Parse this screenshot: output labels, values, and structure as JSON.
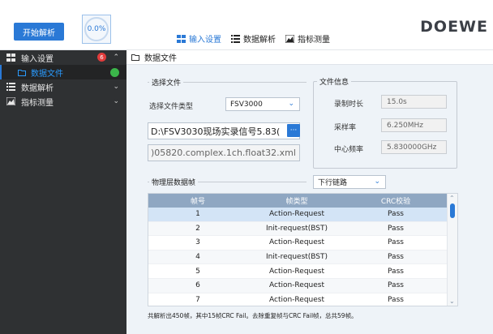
{
  "header": {
    "start_button": "开始解析",
    "progress": "0.0%",
    "tabs": [
      {
        "label": "输入设置",
        "active": true
      },
      {
        "label": "数据解析",
        "active": false
      },
      {
        "label": "指标测量",
        "active": false
      }
    ],
    "logo": "DOEWE"
  },
  "sidebar": {
    "items": [
      {
        "label": "输入设置",
        "badge": "6",
        "expanded": true
      },
      {
        "label": "数据文件",
        "status": "green"
      },
      {
        "label": "数据解析"
      },
      {
        "label": "指标测量"
      }
    ]
  },
  "breadcrumb": "数据文件",
  "select_file": {
    "group_title": "选择文件",
    "type_label": "选择文件类型",
    "type_value": "FSV3000",
    "file_path": "D:\\FSV3030现场实录信号5.83(",
    "browse_label": "···",
    "data_file": ")05820.complex.1ch.float32.xml"
  },
  "file_info": {
    "group_title": "文件信息",
    "duration_label": "录制时长",
    "duration_value": "15.0s",
    "sample_rate_label": "采样率",
    "sample_rate_value": "6.250MHz",
    "center_freq_label": "中心频率",
    "center_freq_value": "5.830000GHz"
  },
  "frames": {
    "group_title": "物理层数据帧",
    "link_value": "下行链路",
    "columns": [
      "帧号",
      "帧类型",
      "CRC校验"
    ],
    "rows": [
      {
        "n": "1",
        "type": "Action-Request",
        "crc": "Pass"
      },
      {
        "n": "2",
        "type": "Init-request(BST)",
        "crc": "Pass"
      },
      {
        "n": "3",
        "type": "Action-Request",
        "crc": "Pass"
      },
      {
        "n": "4",
        "type": "Init-request(BST)",
        "crc": "Pass"
      },
      {
        "n": "5",
        "type": "Action-Request",
        "crc": "Pass"
      },
      {
        "n": "6",
        "type": "Action-Request",
        "crc": "Pass"
      },
      {
        "n": "7",
        "type": "Action-Request",
        "crc": "Pass"
      }
    ],
    "summary": "共解析出450帧，其中15帧CRC Fail。去除重复帧与CRC Fail帧，总共59帧。"
  },
  "colors": {
    "accent": "#2a79d6",
    "sidebar_bg": "#2f3133",
    "table_header": "#8fa7c2",
    "status_green": "#3bb64a",
    "badge_red": "#e23c3c"
  }
}
